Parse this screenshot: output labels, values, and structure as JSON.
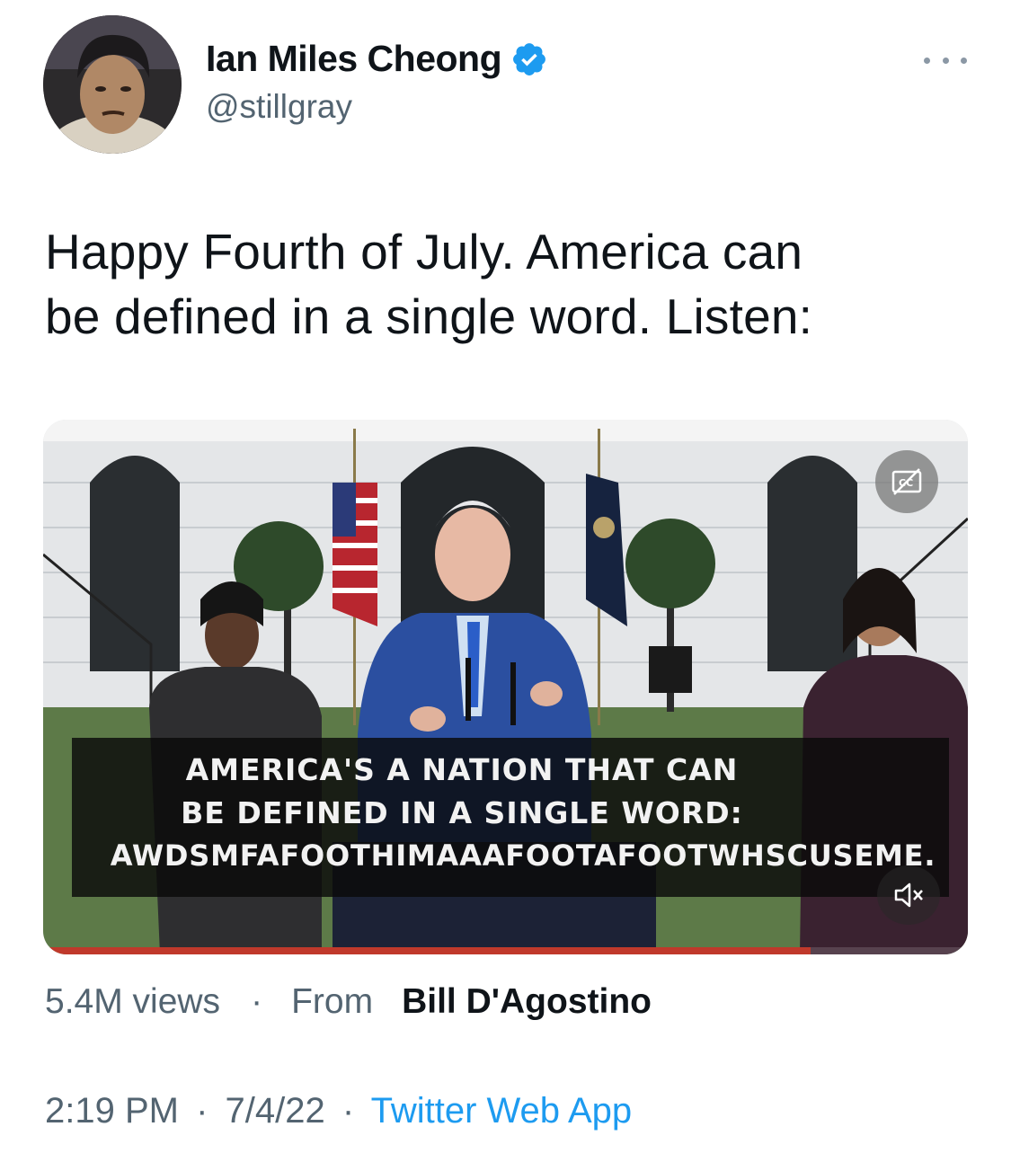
{
  "author": {
    "display_name": "Ian Miles Cheong",
    "handle": "@stillgray",
    "verified": true
  },
  "tweet": {
    "text_line1": "Happy Fourth of July. America can",
    "text_line2": "be defined in a single word. Listen:"
  },
  "media": {
    "type": "video",
    "caption_line1": "AMERICA'S A NATION THAT CAN",
    "caption_line2": "BE DEFINED IN A SINGLE WORD:",
    "caption_line3": "AWDSMFAFOOTHIMAAAFOOTAFOOTWHSCUSEME.",
    "cc_icon": "closed-captions-off-icon",
    "mute_icon": "volume-muted-icon",
    "progress": 0.83
  },
  "stats": {
    "views": "5.4M views",
    "separator": "·",
    "from_label": "From",
    "from_name": "Bill D'Agostino"
  },
  "meta": {
    "time": "2:19 PM",
    "date": "7/4/22",
    "separator": "·",
    "client": "Twitter Web App"
  },
  "colors": {
    "link_blue": "#1d9bf0",
    "secondary_text": "#536471",
    "verified_blue": "#1d9bf0"
  }
}
